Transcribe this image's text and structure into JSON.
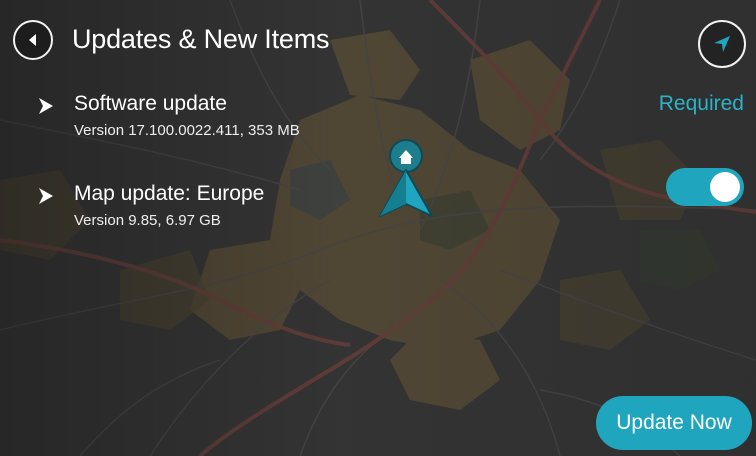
{
  "header": {
    "title": "Updates & New Items",
    "back_icon": "chevron-left-icon",
    "nav_icon": "navigation-arrow-icon"
  },
  "updates": [
    {
      "title": "Software update",
      "subtitle": "Version 17.100.0022.411, 353 MB",
      "status": "Required",
      "icon": "chevron-right-icon"
    },
    {
      "title": "Map update: Europe",
      "subtitle": "Version 9.85, 6.97 GB",
      "toggle_on": true,
      "icon": "chevron-right-icon"
    }
  ],
  "actions": {
    "update_now": "Update Now"
  },
  "map": {
    "marker_icon": "home-pin-icon",
    "position_icon": "current-position-arrow-icon"
  },
  "colors": {
    "accent": "#1fa6be",
    "required_text": "#2bb3c9",
    "map_base": "#3b3b3b",
    "map_urban": "#6e5f43",
    "map_road": "#7a4a44"
  }
}
